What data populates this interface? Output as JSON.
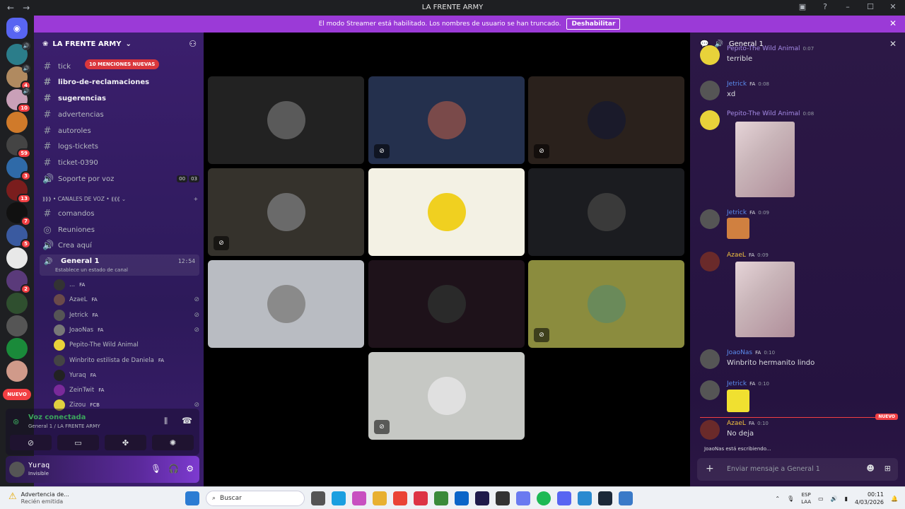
{
  "titlebar": {
    "title": "LA FRENTE ARMY",
    "back": "←",
    "forward": "→"
  },
  "banner": {
    "text": "El modo Streamer está habilitado. Los nombres de usuario se han truncado.",
    "button": "Deshabilitar"
  },
  "servers": [
    {
      "color": "#2b7d8a",
      "badge": ""
    },
    {
      "color": "#b08a60",
      "badge": "4"
    },
    {
      "color": "#c9a0b8",
      "badge": "10"
    },
    {
      "color": "#d07a2a",
      "badge": ""
    },
    {
      "color": "#444",
      "badge": "59"
    },
    {
      "color": "#2f6aa8",
      "badge": "3"
    },
    {
      "color": "#7a1d1d",
      "badge": "13"
    },
    {
      "color": "#111",
      "badge": "7"
    },
    {
      "color": "#3a5aa0",
      "badge": "5"
    },
    {
      "color": "#e8e8e8",
      "badge": ""
    },
    {
      "color": "#5a3a7a",
      "badge": "2"
    },
    {
      "color": "#2f4f2f",
      "badge": ""
    },
    {
      "color": "#555",
      "badge": ""
    },
    {
      "color": "#1a8a3a",
      "badge": ""
    },
    {
      "color": "#d09a8a",
      "badge": ""
    }
  ],
  "nuevo_label": "NUEVO",
  "sidebar": {
    "server_name": "LA FRENTE ARMY",
    "mentions": "10 MENCIONES NUEVAS",
    "channels": [
      {
        "label": "tick",
        "icon": "#"
      },
      {
        "label": "libro-de-reclamaciones",
        "icon": "#"
      },
      {
        "label": "sugerencias",
        "icon": "#"
      },
      {
        "label": "advertencias",
        "icon": "#"
      },
      {
        "label": "autoroles",
        "icon": "#"
      },
      {
        "label": "logs-tickets",
        "icon": "#"
      },
      {
        "label": "ticket-0390",
        "icon": "#"
      },
      {
        "label": "Soporte por voz",
        "icon": "🔊",
        "c1": "00",
        "c2": "03"
      }
    ],
    "voice_category": "CANALES DE VOZ",
    "voice_channels": [
      {
        "label": "comandos",
        "icon": "#"
      },
      {
        "label": "Reuniones",
        "icon": "◎"
      },
      {
        "label": "Crea aquí",
        "icon": "🔊"
      }
    ],
    "general": {
      "name": "General 1",
      "status": "Establece un estado de canal",
      "time": "12:54"
    },
    "voice_users": [
      {
        "name": "...",
        "tag": "FA",
        "color": "#333",
        "muted": ""
      },
      {
        "name": "AzaeL",
        "tag": "FA",
        "color": "#6a4a4a",
        "muted": "🎙"
      },
      {
        "name": "Jetrick",
        "tag": "FA",
        "color": "#555",
        "muted": "🎙"
      },
      {
        "name": "JoaoNas",
        "tag": "FA",
        "color": "#777",
        "muted": "🎙"
      },
      {
        "name": "Pepito-The Wild Animal",
        "tag": "",
        "color": "#e8d23a",
        "muted": ""
      },
      {
        "name": "Winbrito estilista de Daniela",
        "tag": "FA",
        "color": "#444",
        "muted": ""
      },
      {
        "name": "Yuraq",
        "tag": "FA",
        "color": "#222",
        "muted": ""
      },
      {
        "name": "ZeinTwit",
        "tag": "FA",
        "color": "#7a2a9a",
        "muted": ""
      },
      {
        "name": "Zizou",
        "tag": "FCB",
        "color": "#e0d040",
        "muted": "🎙"
      }
    ],
    "voice_connected": {
      "title": "Voz conectada",
      "sub": "General 1 / LA FRENTE ARMY"
    },
    "user": {
      "name": "Yuraq",
      "status": "Invisible"
    }
  },
  "tiles": [
    {
      "bg": "#222222",
      "avatar": "#5a5a5a",
      "muted": false
    },
    {
      "bg": "#24304d",
      "avatar": "#7a4a4a",
      "muted": true
    },
    {
      "bg": "#2a211c",
      "avatar": "#1a1a2a",
      "muted": true
    },
    {
      "bg": "#35322c",
      "avatar": "#6a6a6a",
      "muted": true
    },
    {
      "bg": "#f3f1e4",
      "avatar": "#f0d020",
      "muted": false
    },
    {
      "bg": "#1b1c20",
      "avatar": "#3a3a3a",
      "muted": false
    },
    {
      "bg": "#b9bcc2",
      "avatar": "#8a8a8a",
      "muted": false
    },
    {
      "bg": "#1e121a",
      "avatar": "#2a2a2a",
      "muted": false
    },
    {
      "bg": "#8b8c3e",
      "avatar": "#6a8a5a",
      "muted": true
    },
    {
      "bg": "#c6c8c4",
      "avatar": "#e0e0e0",
      "muted": true
    }
  ],
  "chat": {
    "header": "General 1",
    "messages": [
      {
        "name": "Pepito-The Wild Animal",
        "color": "#a58be6",
        "time": "0:07",
        "tag": "",
        "text": "terrible"
      },
      {
        "name": "Jetrick",
        "color": "#5b8def",
        "time": "0:08",
        "tag": "FA",
        "text": "xd"
      },
      {
        "name": "Pepito-The Wild Animal",
        "color": "#a58be6",
        "time": "0:08",
        "tag": "",
        "text": ""
      },
      {
        "name": "Jetrick",
        "color": "#5b8def",
        "time": "0:09",
        "tag": "FA",
        "text": ""
      },
      {
        "name": "AzaeL",
        "color": "#f0c040",
        "time": "0:09",
        "tag": "FA",
        "text": ""
      },
      {
        "name": "JoaoNas",
        "color": "#5b8def",
        "time": "0:10",
        "tag": "FA",
        "text": "Winbrito hermanito lindo"
      },
      {
        "name": "Jetrick",
        "color": "#5b8def",
        "time": "0:10",
        "tag": "FA",
        "text": ""
      },
      {
        "name": "AzaeL",
        "color": "#f0c040",
        "time": "0:10",
        "tag": "FA",
        "text": "No deja"
      }
    ],
    "new_label": "NUEVO",
    "typing": "JoaoNas está escribiendo...",
    "placeholder": "Enviar mensaje a   General 1"
  },
  "taskbar": {
    "warn_title": "Advertencia de...",
    "warn_sub": "Recién emitida",
    "search": "Buscar",
    "lang1": "ESP",
    "lang2": "LAA",
    "time": "00:11",
    "date": "4/03/2026"
  }
}
